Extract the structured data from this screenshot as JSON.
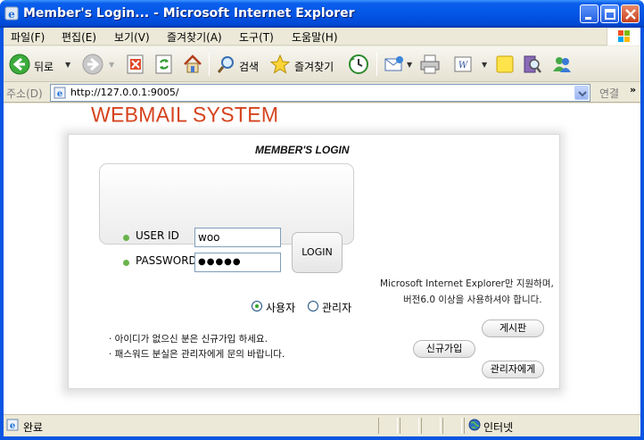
{
  "window": {
    "title": "Member's Login... - Microsoft Internet Explorer"
  },
  "menu": [
    "파일(F)",
    "편집(E)",
    "보기(V)",
    "즐겨찾기(A)",
    "도구(T)",
    "도움말(H)"
  ],
  "toolbar": {
    "back_label": "뒤로",
    "search_label": "검색",
    "favorites_label": "즐겨찾기"
  },
  "address": {
    "label": "주소(D)",
    "url": "http://127.0.0.1:9005/",
    "go_label": "연결",
    "more": "»"
  },
  "page": {
    "brand": "WEBMAIL SYSTEM",
    "subtitle": "MEMBER'S LOGIN",
    "user_id_label": "USER ID",
    "user_id_value": "woo",
    "password_label": "PASSWORD",
    "password_value": "●●●●●",
    "login_button": "LOGIN",
    "radio_user": "사용자",
    "radio_admin": "관리자",
    "selected_role": "사용자",
    "note1": "· 아이디가 없으신 분은 신규가입 하세요.",
    "note2": "· 패스워드 분실은 관리자에게 문의 바랍니다.",
    "browser_note1": "Microsoft Internet Explorer만 지원하며,",
    "browser_note2": "버전6.0 이상을 사용하셔야 합니다.",
    "board_button": "게시판",
    "signup_button": "신규가입",
    "to_admin_button": "관리자에게"
  },
  "status": {
    "text": "완료",
    "zone": "인터넷"
  },
  "colors": {
    "brand": "#d5441e",
    "titlebar": "#0356e6",
    "dot": "#69b34c"
  }
}
